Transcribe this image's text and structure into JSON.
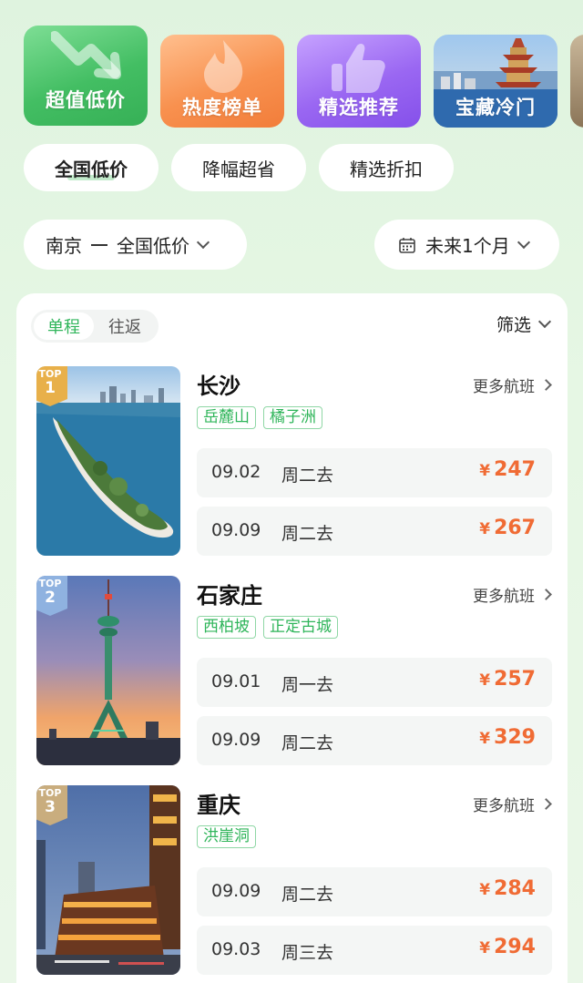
{
  "tiles": [
    {
      "label": "超值低价",
      "icon": "arrow-down-trend-icon"
    },
    {
      "label": "热度榜单",
      "icon": "flame-icon"
    },
    {
      "label": "精选推荐",
      "icon": "thumbs-up-icon"
    },
    {
      "label": "宝藏冷门",
      "icon": "pagoda-photo"
    }
  ],
  "chips": [
    {
      "label": "全国低价",
      "active": true
    },
    {
      "label": "降幅超省",
      "active": false
    },
    {
      "label": "精选折扣",
      "active": false
    }
  ],
  "route": {
    "from": "南京",
    "to": "全国低价"
  },
  "date_range": {
    "label": "未来1个月"
  },
  "trip_toggle": {
    "one_way": "单程",
    "round_trip": "往返"
  },
  "filter_label": "筛选",
  "destinations": [
    {
      "rank_label": "TOP",
      "rank": "1",
      "city": "长沙",
      "more": "更多航班",
      "tags": [
        "岳麓山",
        "橘子洲"
      ],
      "flights": [
        {
          "date": "09.02",
          "day": "周二去",
          "currency": "¥",
          "price": "247"
        },
        {
          "date": "09.09",
          "day": "周二去",
          "currency": "¥",
          "price": "267"
        }
      ]
    },
    {
      "rank_label": "TOP",
      "rank": "2",
      "city": "石家庄",
      "more": "更多航班",
      "tags": [
        "西柏坡",
        "正定古城"
      ],
      "flights": [
        {
          "date": "09.01",
          "day": "周一去",
          "currency": "¥",
          "price": "257"
        },
        {
          "date": "09.09",
          "day": "周二去",
          "currency": "¥",
          "price": "329"
        }
      ]
    },
    {
      "rank_label": "TOP",
      "rank": "3",
      "city": "重庆",
      "more": "更多航班",
      "tags": [
        "洪崖洞"
      ],
      "flights": [
        {
          "date": "09.09",
          "day": "周二去",
          "currency": "¥",
          "price": "284"
        },
        {
          "date": "09.03",
          "day": "周三去",
          "currency": "¥",
          "price": "294"
        }
      ]
    }
  ],
  "colors": {
    "accent_green": "#2fb55a",
    "price_orange": "#f06b34"
  }
}
